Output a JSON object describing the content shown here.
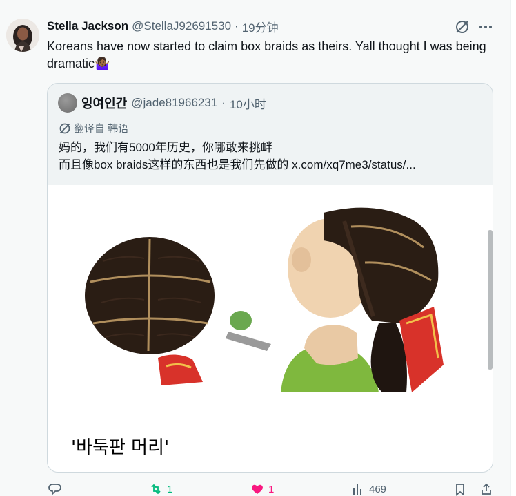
{
  "tweet": {
    "display_name": "Stella Jackson",
    "handle": "@StellaJ92691530",
    "separator": "·",
    "time": "19分钟",
    "text": "Koreans have now started to claim box braids as theirs. Yall thought I was being dramatic🤷🏾‍♀️"
  },
  "quote": {
    "display_name": "잉여인간",
    "handle": "@jade81966231",
    "separator": "·",
    "time": "10小时",
    "translate_label": "翻译自 韩语",
    "line1": "妈的，我们有5000年历史，你哪敢来挑衅",
    "line2_text": "而且像box braids这样的东西也是我们先做的 ",
    "line2_link": "x.com/xq7me3/status/...",
    "media_caption": "'바둑판 머리'"
  },
  "actions": {
    "reply_count": "",
    "retweet_count": "1",
    "like_count": "1",
    "views_count": "469"
  },
  "icons": [
    "grok-icon",
    "more-icon",
    "translate-icon",
    "reply-icon",
    "retweet-icon",
    "heart-icon",
    "views-icon",
    "bookmark-icon",
    "share-icon"
  ],
  "colors": {
    "retweet": "#00ba7c",
    "like": "#f91880",
    "secondary": "#536471"
  }
}
